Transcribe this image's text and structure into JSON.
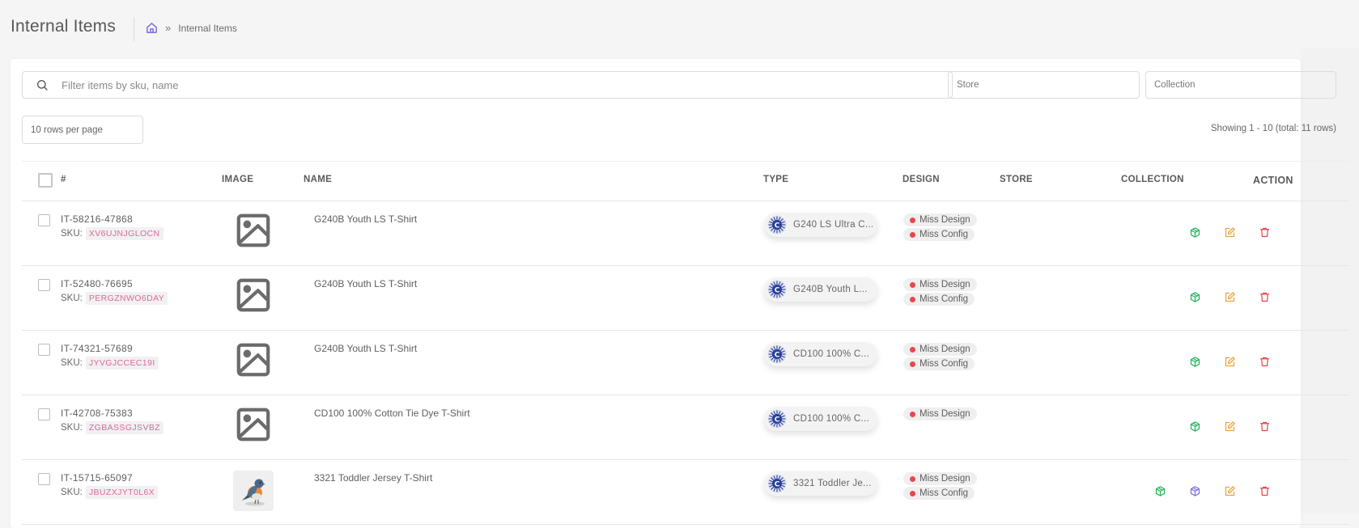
{
  "header": {
    "title": "Internal Items",
    "breadcrumb": {
      "home_icon": "home-icon",
      "separator": "»",
      "current": "Internal Items"
    },
    "actions": [
      {
        "name": "download-button",
        "icon": "download-icon",
        "color": "#4dd7e8"
      },
      {
        "name": "export-button",
        "icon": "upload-icon",
        "color": "#a29bf2"
      },
      {
        "name": "cloud-upload-button",
        "icon": "cloud-upload-icon",
        "color": "#a29bf2"
      },
      {
        "name": "add-button",
        "icon": "plus-circle-icon",
        "color": "#22c55e"
      },
      {
        "name": "delete-button",
        "icon": "trash-icon",
        "color": "#ee8e92"
      }
    ]
  },
  "filters": {
    "search_placeholder": "Filter items by sku, name",
    "search_value": "",
    "store_placeholder": "Store",
    "collection_placeholder": "Collection",
    "rows_per_page": "10 rows per page",
    "showing": "Showing 1 - 10 (total: 11 rows)"
  },
  "table": {
    "columns": {
      "id": "#",
      "image": "IMAGE",
      "name": "NAME",
      "type": "TYPE",
      "design": "DESIGN",
      "store": "STORE",
      "collection": "COLLECTION",
      "action": "ACTION"
    },
    "sku_label": "SKU:",
    "rows": [
      {
        "id": "IT-58216-47868",
        "sku": "XV6UJNJGLOCN",
        "image": "placeholder",
        "name": "G240B Youth LS T-Shirt",
        "type": "G240 LS Ultra C...",
        "design": [
          "Miss Design",
          "Miss Config"
        ],
        "store": "",
        "collection": "",
        "actions": [
          "product",
          "edit",
          "delete"
        ]
      },
      {
        "id": "IT-52480-76695",
        "sku": "PERGZNWO6DAY",
        "image": "placeholder",
        "name": "G240B Youth LS T-Shirt",
        "type": "G240B Youth L...",
        "design": [
          "Miss Design",
          "Miss Config"
        ],
        "store": "",
        "collection": "",
        "actions": [
          "product",
          "edit",
          "delete"
        ]
      },
      {
        "id": "IT-74321-57689",
        "sku": "JYVGJCCEC19I",
        "image": "placeholder",
        "name": "G240B Youth LS T-Shirt",
        "type": "CD100 100% C...",
        "design": [
          "Miss Design",
          "Miss Config"
        ],
        "store": "",
        "collection": "",
        "actions": [
          "product",
          "edit",
          "delete"
        ]
      },
      {
        "id": "IT-42708-75383",
        "sku": "ZGBASSGJSVBZ",
        "image": "placeholder",
        "name": "CD100 100% Cotton Tie Dye T-Shirt",
        "type": "CD100 100% C...",
        "design": [
          "Miss Design"
        ],
        "store": "",
        "collection": "",
        "actions": [
          "product",
          "edit",
          "delete"
        ]
      },
      {
        "id": "IT-15715-65097",
        "sku": "JBUZXJYT0L6X",
        "image": "bird-photo",
        "name": "3321 Toddler Jersey T-Shirt",
        "type": "3321 Toddler Je...",
        "design": [
          "Miss Design",
          "Miss Config"
        ],
        "store": "",
        "collection": "",
        "actions": [
          "product",
          "product-alt",
          "edit",
          "delete"
        ]
      }
    ]
  },
  "colors": {
    "sku_text": "#e0669b",
    "status_dot": "#e5484d",
    "action_product": "#22b45a",
    "action_product_alt": "#7c6fe0",
    "action_edit": "#f0a13c",
    "action_delete": "#e5484d"
  }
}
